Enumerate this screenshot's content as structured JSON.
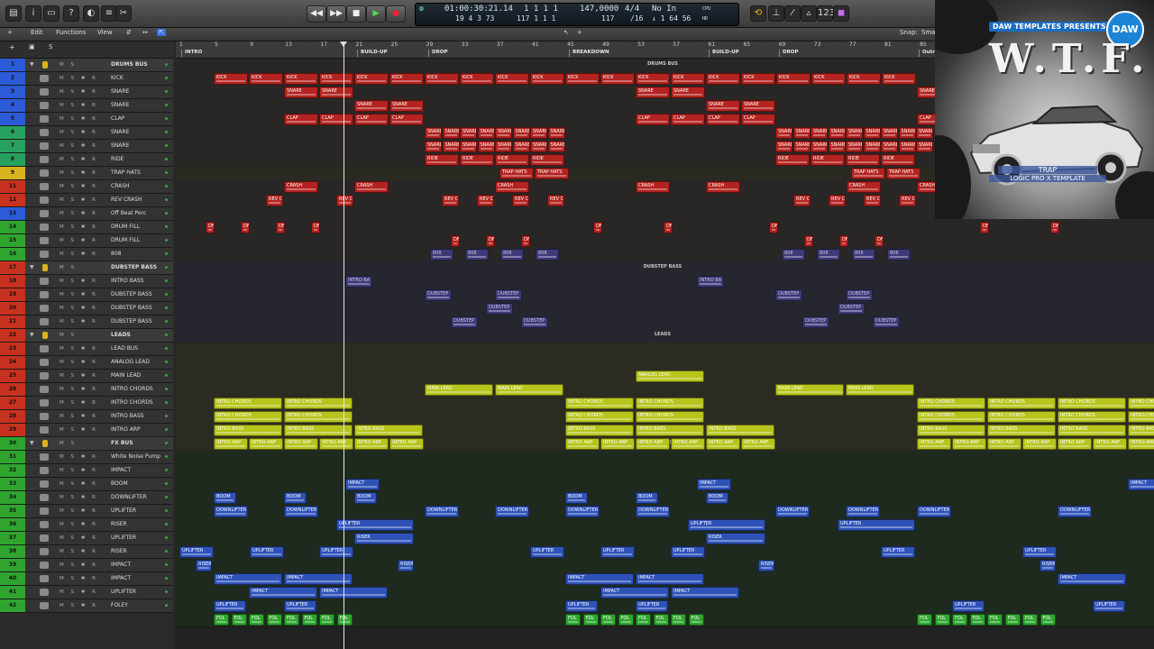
{
  "control_bar": {
    "lcd": {
      "time": "01:00:30:21.14",
      "time_sub": "19  4  3    73",
      "position": "1   1   1     1",
      "position_sub": "117   1   1     1",
      "tempo": "147,0000",
      "tempo_sub": "117",
      "signature": "4/4",
      "division": "/16",
      "midi_in": "No In",
      "midi_out": "↓ 1  64  56",
      "cpu_label": "CPU",
      "hd_label": "HD"
    }
  },
  "window": {
    "menu": {
      "edit": "Edit",
      "functions": "Functions",
      "view": "View",
      "snap": "Snap:",
      "snap_value": "Sma"
    },
    "ruler": {
      "bars": [
        "1",
        "5",
        "9",
        "13",
        "17",
        "21",
        "25",
        "29",
        "33",
        "37",
        "41",
        "45",
        "49",
        "53",
        "57",
        "61",
        "65",
        "69",
        "73",
        "77",
        "81",
        "85"
      ],
      "markers": [
        "INTRO",
        "BUILD-UP",
        "DROP",
        "BREAKDOWN",
        "BUILD-UP",
        "DROP",
        "Outr"
      ]
    },
    "tracks": [
      {
        "num": "1",
        "name": "DRUMS BUS",
        "color": "#2c5bd8",
        "folder": true
      },
      {
        "num": "2",
        "name": "KICK",
        "color": "#2c5bd8"
      },
      {
        "num": "3",
        "name": "SNARE",
        "color": "#2c5bd8"
      },
      {
        "num": "4",
        "name": "SNARE",
        "color": "#2c5bd8"
      },
      {
        "num": "5",
        "name": "CLAP",
        "color": "#2c5bd8"
      },
      {
        "num": "6",
        "name": "SNARE",
        "color": "#27a25e"
      },
      {
        "num": "7",
        "name": "SNARE",
        "color": "#27a25e"
      },
      {
        "num": "8",
        "name": "RIDE",
        "color": "#27a25e"
      },
      {
        "num": "9",
        "name": "TRAP HATS",
        "color": "#d9b21f"
      },
      {
        "num": "11",
        "name": "CRASH",
        "color": "#c7311f"
      },
      {
        "num": "12",
        "name": "REV CRASH",
        "color": "#c7311f"
      },
      {
        "num": "13",
        "name": "Off Beat Perc",
        "color": "#2c5bd8"
      },
      {
        "num": "14",
        "name": "DRUM FILL",
        "color": "#2fa52f"
      },
      {
        "num": "15",
        "name": "DRUM FILL",
        "color": "#2fa52f"
      },
      {
        "num": "16",
        "name": "808",
        "color": "#2fa52f"
      },
      {
        "num": "17",
        "name": "DUBSTEP BASS",
        "color": "#c7311f",
        "folder": true
      },
      {
        "num": "18",
        "name": "INTRO BASS",
        "color": "#c7311f"
      },
      {
        "num": "19",
        "name": "DUBSTEP BASS",
        "color": "#c7311f"
      },
      {
        "num": "20",
        "name": "DUBSTEP BASS",
        "color": "#c7311f"
      },
      {
        "num": "21",
        "name": "DUBSTEP BASS",
        "color": "#c7311f"
      },
      {
        "num": "22",
        "name": "LEADS",
        "color": "#c7311f",
        "folder": true
      },
      {
        "num": "23",
        "name": "LEAD BUS",
        "color": "#c7311f"
      },
      {
        "num": "24",
        "name": "ANALOG LEAD",
        "color": "#c7311f"
      },
      {
        "num": "25",
        "name": "MAIN LEAD",
        "color": "#c7311f"
      },
      {
        "num": "26",
        "name": "INTRO CHORDS",
        "color": "#c7311f"
      },
      {
        "num": "27",
        "name": "INTRO CHORDS",
        "color": "#c7311f"
      },
      {
        "num": "28",
        "name": "INTRO BASS",
        "color": "#c7311f"
      },
      {
        "num": "29",
        "name": "INTRO ARP",
        "color": "#c7311f"
      },
      {
        "num": "30",
        "name": "FX BUS",
        "color": "#2fa52f",
        "folder": true
      },
      {
        "num": "31",
        "name": "White Noise Pump",
        "color": "#2fa52f"
      },
      {
        "num": "32",
        "name": "IMPACT",
        "color": "#2fa52f"
      },
      {
        "num": "33",
        "name": "BOOM",
        "color": "#2fa52f"
      },
      {
        "num": "34",
        "name": "DOWNLIFTER",
        "color": "#2fa52f"
      },
      {
        "num": "35",
        "name": "UPLIFTER",
        "color": "#2fa52f"
      },
      {
        "num": "36",
        "name": "RISER",
        "color": "#2fa52f"
      },
      {
        "num": "37",
        "name": "UPLIFTER",
        "color": "#2fa52f"
      },
      {
        "num": "38",
        "name": "RISER",
        "color": "#2fa52f"
      },
      {
        "num": "39",
        "name": "IMPACT",
        "color": "#2fa52f"
      },
      {
        "num": "40",
        "name": "IMPACT",
        "color": "#2fa52f"
      },
      {
        "num": "41",
        "name": "UPLIFTER",
        "color": "#2fa52f"
      },
      {
        "num": "42",
        "name": "FOLEY",
        "color": "#2fa52f"
      }
    ],
    "bus_labels": {
      "drums": "DRUMS BUS",
      "dubstep": "DUBSTEP BASS",
      "leads": "LEADS",
      "fx": "FX BUS"
    },
    "region_names": {
      "kick": "KICK",
      "snare": "SNARE",
      "clap": "CLAP",
      "ride": "RIDE",
      "trap_hats": "TRAP HATS",
      "crash": "CRASH",
      "rev_crash": "REV C",
      "drum_fill": "DF",
      "eight_oh_eight": "808",
      "intro_bass_short": "INTRO BA",
      "dubstep": "DUBSTEP",
      "analog_lead": "ANALOG LEAD",
      "main_lead": "MAIN LEAD",
      "intro_chords": "INTRO CHORDS",
      "intro_bass": "INTRO BASS",
      "intro_arp": "INTRO ARP",
      "impact": "IMPACT",
      "boom": "BOOM",
      "downlifter": "DOWNLIFTER",
      "uplifter": "UPLIFTER",
      "riser": "RISER",
      "foley": "FOL"
    }
  },
  "cover": {
    "presents": "DAW TEMPLATES PRESENTS",
    "logo": "DAW",
    "title": "W.T.F.",
    "genre": "TRAP",
    "subtitle": "LOGIC PRO X TEMPLATE"
  }
}
